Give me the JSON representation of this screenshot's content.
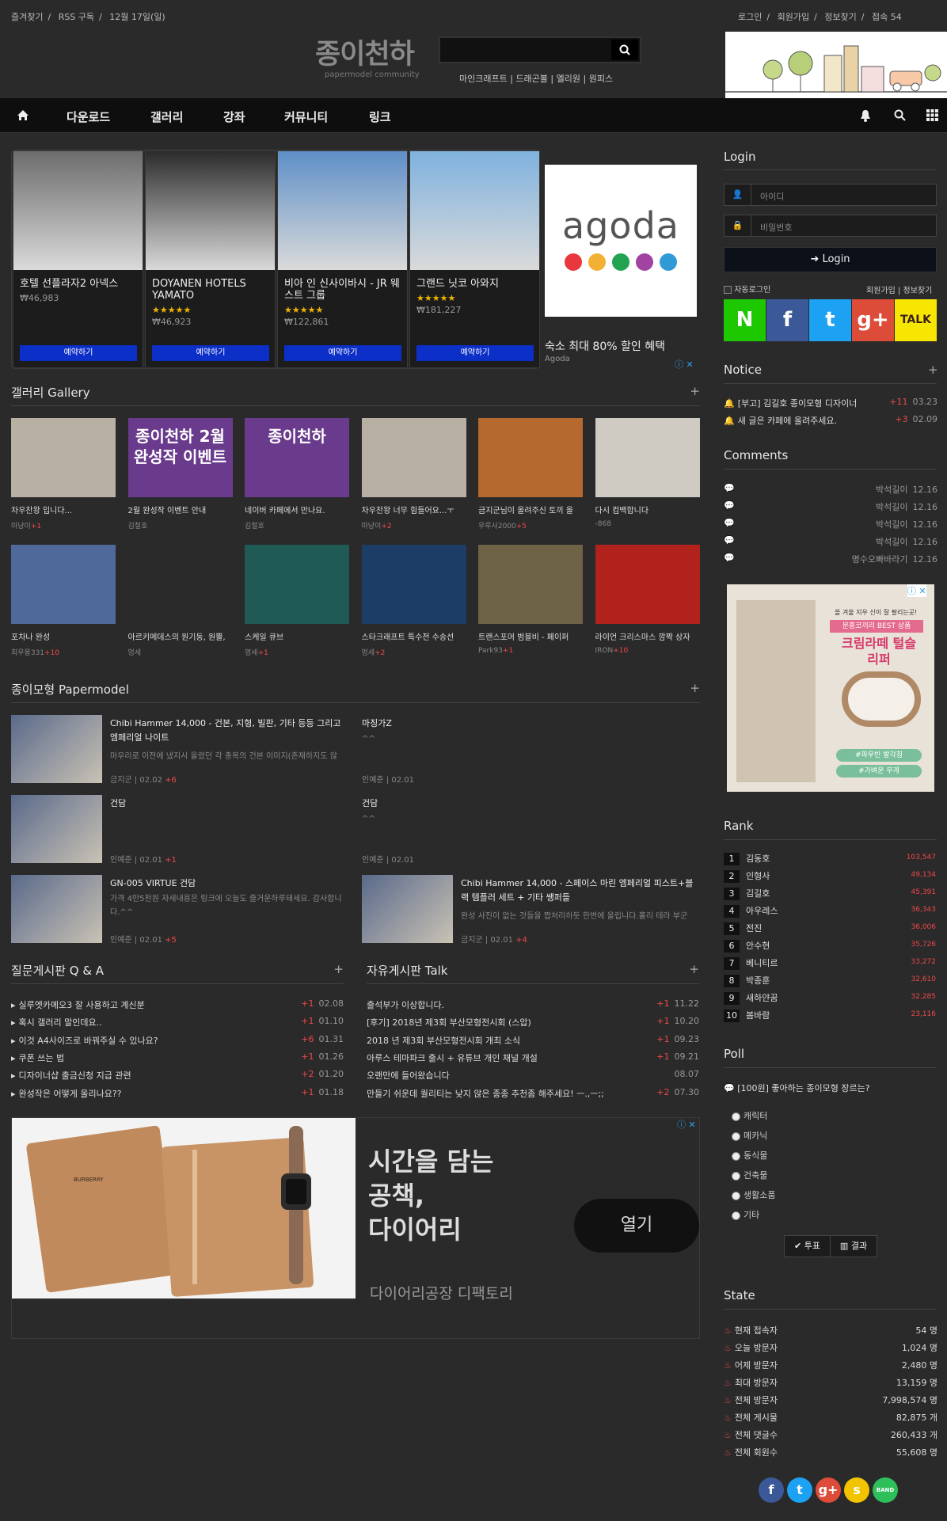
{
  "top_left": [
    "즐겨찾기",
    "RSS 구독",
    "12월 17일(일)"
  ],
  "top_right": [
    "로그인",
    "회원가입",
    "정보찾기",
    "접속 54"
  ],
  "logo": {
    "title": "종이천하",
    "sub": "papermodel community"
  },
  "quick_links": [
    "마인크래프트",
    "드래곤볼",
    "엘리원",
    "원피스"
  ],
  "nav": [
    "다운로드",
    "갤러리",
    "강좌",
    "커뮤니티",
    "링크"
  ],
  "hotels": [
    {
      "name": "호텔 선플라자2 아넥스",
      "stars": "",
      "price": "₩46,983",
      "button": "예약하기"
    },
    {
      "name": "DOYANEN HOTELS YAMATO",
      "stars": "★★★★★",
      "price": "₩46,923",
      "button": "예약하기"
    },
    {
      "name": "비아 인 신사이바시 - JR 웨스트 그룹",
      "stars": "★★★★★",
      "price": "₩122,861",
      "button": "예약하기"
    },
    {
      "name": "그랜드 닛코 아와지",
      "stars": "★★★★★",
      "price": "₩181,227",
      "button": "예약하기"
    }
  ],
  "agoda": {
    "brand": "agoda",
    "text": "숙소 최대 80% 할인 혜택",
    "sub": "Agoda",
    "colors": [
      "#e8383d",
      "#f2b134",
      "#23a351",
      "#a043a1",
      "#2f9ad6"
    ]
  },
  "gallery": {
    "title": "갤러리 Gallery",
    "items": [
      {
        "t": "차우찬왕 입니다...",
        "a": "마냥이",
        "c": "+1",
        "bg": "#b9b0a4"
      },
      {
        "t": "2월 완성작 이벤트 안내",
        "a": "김철호",
        "c": "",
        "bg": "#6a3a8c",
        "label": "종이천하 2월 완성작 이벤트"
      },
      {
        "t": "네이버 카페에서 만나요.",
        "a": "김철호",
        "c": "",
        "bg": "#6a3a8c",
        "label": "종이천하"
      },
      {
        "t": "차우찬왕 너무 힘들어요...ㅜ",
        "a": "마냥이",
        "c": "+2",
        "bg": "#b9b0a4"
      },
      {
        "t": "금지군님이 올려주신 토끼 올",
        "a": "우루사2000",
        "c": "+5",
        "bg": "#b5692f"
      },
      {
        "t": "다시 컴백합니다",
        "a": "-868",
        "c": "",
        "bg": "#cfcac2"
      },
      {
        "t": "포차나 완성",
        "a": "최우용331",
        "c": "+10",
        "bg": "#4f6a9a"
      },
      {
        "t": "아르키메데스의 원기둥, 원뿔,",
        "a": "멍세",
        "c": "",
        "bg": "#2a2a2b"
      },
      {
        "t": "스케일 큐브",
        "a": "멍세",
        "c": "+1",
        "bg": "#1f5a55"
      },
      {
        "t": "스타크래프트 특수전 수송선",
        "a": "멍세",
        "c": "+2",
        "bg": "#1c3e66"
      },
      {
        "t": "트랜스포머 범블비 - 페이퍼",
        "a": "Park93",
        "c": "+1",
        "bg": "#6e6247"
      },
      {
        "t": "라이언 크리스마스 깜짝 상자",
        "a": "IRON",
        "c": "+10",
        "bg": "#b2221d"
      }
    ]
  },
  "papermodel": {
    "title": "종이모형 Papermodel",
    "items": [
      {
        "t": "Chibi Hammer 14,000 - 건본, 지형, 빌판, 기타 등등 그리고 엠페리얼 나이트",
        "d": "마우리로 이전에 냈지시 올렸던 각 종목의 건본 이미지(존재하지도 않",
        "a": "금지군",
        "date": "02.02",
        "c": "+6",
        "img": true
      },
      {
        "t": "마징가Z",
        "d": "^^",
        "a": "인예준",
        "date": "02.01",
        "c": "",
        "img": false
      },
      {
        "t": "건담",
        "d": "",
        "a": "인예준",
        "date": "02.01",
        "c": "+1",
        "img": true
      },
      {
        "t": "건담",
        "d": "^^",
        "a": "인예준",
        "date": "02.01",
        "c": "",
        "img": false
      },
      {
        "t": "GN-005 VIRTUE 건담",
        "d": "가격 4만5천원 자세내용은 링크에 오늘도 즐거운하루돼세요. 감사합니다.^^",
        "a": "인예준",
        "date": "02.01",
        "c": "+5",
        "img": true
      },
      {
        "t": "Chibi Hammer 14,000 - 스페이스 마린 엠페리얼 피스트+블랙 템플러 세트 + 기타 쌩퍼들",
        "d": "완성 사진이 없는 것들을 짭처리하듯 한번에 올립니다.홀리 테라 부군",
        "a": "금지군",
        "date": "02.01",
        "c": "+4",
        "img": true
      }
    ]
  },
  "qna": {
    "title": "질문게시판 Q & A",
    "rows": [
      {
        "t": "실루엣카메오3 잘 사용하고 계신분",
        "c": "+1",
        "d": "02.08"
      },
      {
        "t": "혹시 갤러리 말인데요..",
        "c": "+1",
        "d": "01.10"
      },
      {
        "t": "이것 A4사이즈로 바꿔주실 수 있나요?",
        "c": "+6",
        "d": "01.31"
      },
      {
        "t": "쿠폰 쓰는 법",
        "c": "+1",
        "d": "01.26"
      },
      {
        "t": "디자이너샵 출금신청 지급 관련",
        "c": "+2",
        "d": "01.20"
      },
      {
        "t": "완성작은 어떻게 올리나요??",
        "c": "+1",
        "d": "01.18"
      }
    ]
  },
  "talk": {
    "title": "자유게시판 Talk",
    "rows": [
      {
        "t": "출석부가 이상합니다.",
        "c": "+1",
        "d": "11.22"
      },
      {
        "t": "[후기] 2018년 제3회 부산모형전시회 (스압)",
        "c": "+1",
        "d": "10.20"
      },
      {
        "t": "2018 년 제3회 부산모형전시회 개최 소식",
        "c": "+1",
        "d": "09.23"
      },
      {
        "t": "아루스 테마파크 출시 + 유튜브 개인 채널 개설",
        "c": "+1",
        "d": "09.21"
      },
      {
        "t": "오랜만에 들어왔습니다",
        "c": "",
        "d": "08.07"
      },
      {
        "t": "만들기 쉬운데 퀄리티는 낮지 않은 종종 추천좀 해주세요! ㅡ.,ㅡ;;",
        "c": "+2",
        "d": "07.30"
      }
    ]
  },
  "big_ad": {
    "headline": [
      "시간을 담는",
      "공책,",
      "다이어리"
    ],
    "button": "열기",
    "sub": "다이어리공장 디팩토리",
    "brand": "BURBERRY"
  },
  "login": {
    "title": "Login",
    "id_ph": "아이디",
    "pw_ph": "비밀번호",
    "button": "Login",
    "auto": "자동로그인",
    "links": "회원가입 | 정보찾기"
  },
  "social": [
    {
      "label": "N",
      "color": "#1ec800"
    },
    {
      "label": "f",
      "color": "#3b5998"
    },
    {
      "label": "t",
      "color": "#1da1f2"
    },
    {
      "label": "g+",
      "color": "#dd4b39"
    },
    {
      "label": "TALK",
      "color": "#f7e600"
    }
  ],
  "notice": {
    "title": "Notice",
    "rows": [
      {
        "t": "[부고] 김길호 종이모형 디자이너",
        "c": "+11",
        "d": "03.23"
      },
      {
        "t": "새 글은 카페에 올려주세요.",
        "c": "+3",
        "d": "02.09"
      }
    ]
  },
  "comments": {
    "title": "Comments",
    "rows": [
      {
        "a": "박석길이",
        "d": "12.16"
      },
      {
        "a": "박석길이",
        "d": "12.16"
      },
      {
        "a": "박석길이",
        "d": "12.16"
      },
      {
        "a": "박석길이",
        "d": "12.16"
      },
      {
        "a": "명수오빠바라기",
        "d": "12.16"
      }
    ]
  },
  "side_ad": {
    "text": "올 겨울 지우 신이 잘 팔리는곳!",
    "badge": "분홍코끼리 BEST 상품",
    "title": "크림라떼 털슬리퍼",
    "tags": [
      "#파우빈 발각칭",
      "#가벼운 무게"
    ]
  },
  "rank": {
    "title": "Rank",
    "rows": [
      {
        "n": "1",
        "name": "김동호",
        "s": "103,547"
      },
      {
        "n": "2",
        "name": "인형사",
        "s": "49,134"
      },
      {
        "n": "3",
        "name": "김길호",
        "s": "45,391"
      },
      {
        "n": "4",
        "name": "아우레스",
        "s": "36,343"
      },
      {
        "n": "5",
        "name": "전진",
        "s": "36,006"
      },
      {
        "n": "6",
        "name": "안수현",
        "s": "35,726"
      },
      {
        "n": "7",
        "name": "베니티르",
        "s": "33,272"
      },
      {
        "n": "8",
        "name": "박종훈",
        "s": "32,610"
      },
      {
        "n": "9",
        "name": "새하얀꿈",
        "s": "32,285"
      },
      {
        "n": "10",
        "name": "봄바람",
        "s": "23,116"
      }
    ]
  },
  "poll": {
    "title": "Poll",
    "question": "[100원] 좋아하는 종이모형 장르는?",
    "options": [
      "캐릭터",
      "메카닉",
      "동식물",
      "건축물",
      "생활소품",
      "기타"
    ],
    "vote": "투표",
    "result": "결과"
  },
  "state": {
    "title": "State",
    "rows": [
      {
        "k": "현재 접속자",
        "v": "54 명"
      },
      {
        "k": "오늘 방문자",
        "v": "1,024 명"
      },
      {
        "k": "어제 방문자",
        "v": "2,480 명"
      },
      {
        "k": "최대 방문자",
        "v": "13,159 명"
      },
      {
        "k": "전체 방문자",
        "v": "7,998,574 명"
      },
      {
        "k": "전체 게시물",
        "v": "82,875 개"
      },
      {
        "k": "전체 댓글수",
        "v": "260,433 개"
      },
      {
        "k": "전체 회원수",
        "v": "55,608 명"
      }
    ]
  },
  "footer_social": [
    {
      "label": "f",
      "color": "#3b5998"
    },
    {
      "label": "t",
      "color": "#1da1f2"
    },
    {
      "label": "g+",
      "color": "#dd4b39"
    },
    {
      "label": "s",
      "color": "#f2c400"
    },
    {
      "label": "BAND",
      "color": "#2fbf5a"
    }
  ]
}
